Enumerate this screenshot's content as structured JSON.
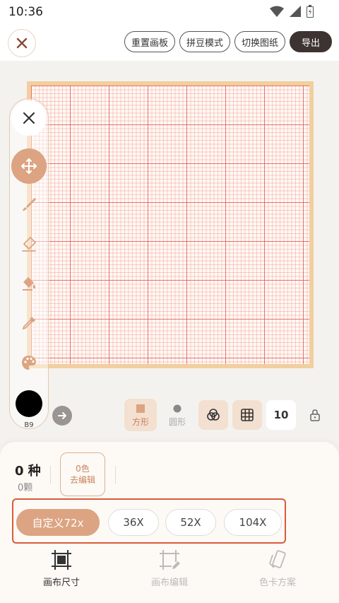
{
  "status": {
    "time": "10:36"
  },
  "header": {
    "buttons": [
      {
        "label": "重置画板"
      },
      {
        "label": "拼豆模式"
      },
      {
        "label": "切换图纸"
      }
    ],
    "export_label": "导出"
  },
  "toolbar": {
    "tools": [
      "close-icon",
      "move-icon",
      "pen-icon",
      "eraser-icon",
      "fill-icon",
      "picker-icon",
      "palette-icon"
    ],
    "active_tool": "move-icon",
    "current_color": {
      "code": "B9",
      "hex": "#000000"
    }
  },
  "controls": {
    "shapes": [
      {
        "label": "方形",
        "active": true
      },
      {
        "label": "圆形",
        "active": false
      }
    ],
    "zoom": "10"
  },
  "summary": {
    "count": "0 种",
    "beads": "0颗",
    "edit_colors": {
      "line1": "0色",
      "line2": "去编辑"
    }
  },
  "sizes": [
    {
      "label": "自定义72x",
      "active": true
    },
    {
      "label": "36X",
      "active": false
    },
    {
      "label": "52X",
      "active": false
    },
    {
      "label": "104X",
      "active": false
    }
  ],
  "bottom_nav": [
    {
      "label": "画布尺寸",
      "active": true
    },
    {
      "label": "画布编辑",
      "active": false
    },
    {
      "label": "色卡方案",
      "active": false
    }
  ],
  "colors": {
    "accent": "#dca482",
    "dark": "#3d3330",
    "highlight": "#d85b3a"
  }
}
